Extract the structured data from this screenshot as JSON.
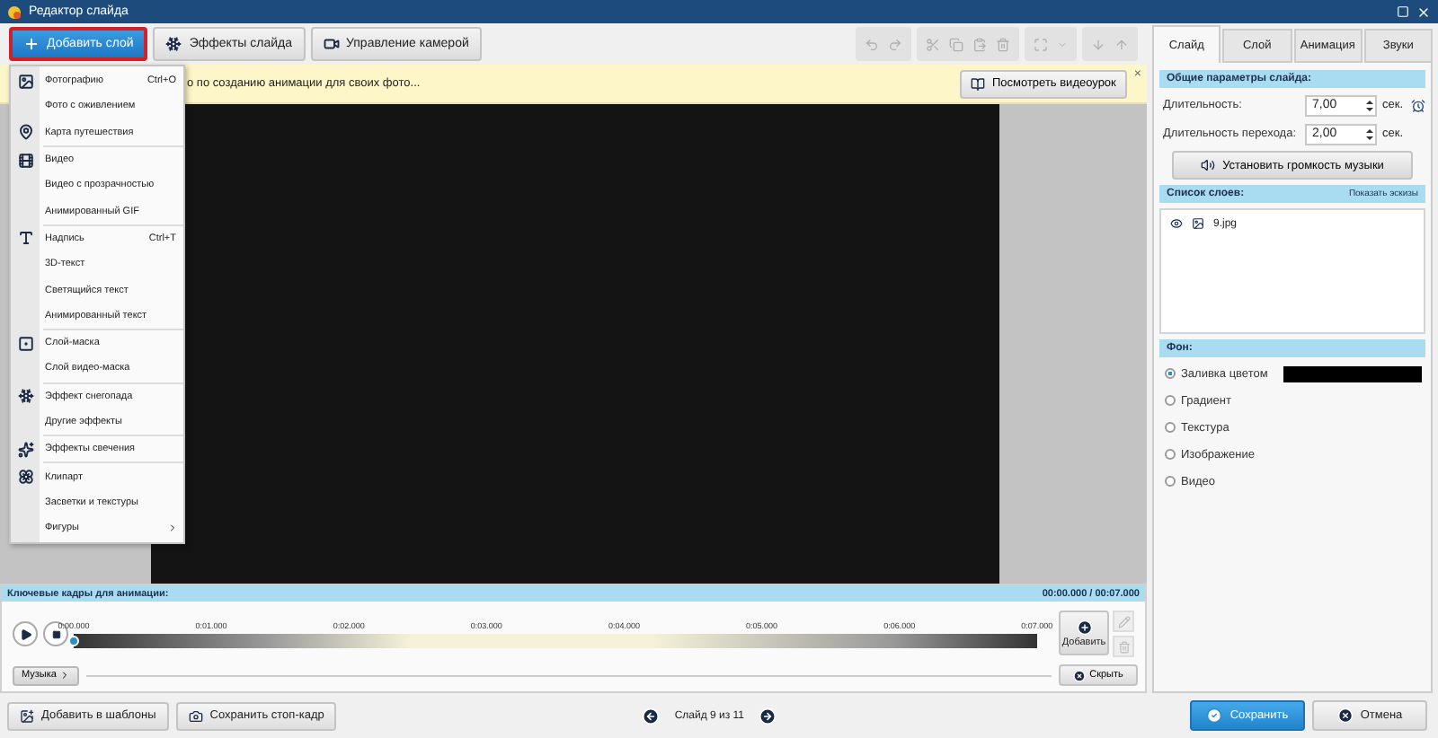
{
  "window": {
    "title": "Редактор слайда"
  },
  "toolbar": {
    "buttons": [
      {
        "label": "Добавить слой",
        "selected": true
      },
      {
        "label": "Эффекты слайда",
        "selected": false
      },
      {
        "label": "Управление камерой",
        "selected": false
      }
    ]
  },
  "add_layer_menu": {
    "groups": [
      {
        "items": [
          {
            "label": "Фотографию",
            "shortcut": "Ctrl+O"
          },
          {
            "label": "Фото с оживлением"
          },
          {
            "label": "Карта путешествия"
          }
        ]
      },
      {
        "items": [
          {
            "label": "Видео"
          },
          {
            "label": "Видео с прозрачностью"
          },
          {
            "label": "Анимированный GIF"
          }
        ]
      },
      {
        "items": [
          {
            "label": "Надпись",
            "shortcut": "Ctrl+T"
          },
          {
            "label": "3D-текст"
          },
          {
            "label": "Светящийся текст"
          },
          {
            "label": "Анимированный текст"
          }
        ]
      },
      {
        "items": [
          {
            "label": "Слой-маска"
          },
          {
            "label": "Слой видео-маска"
          }
        ]
      },
      {
        "items": [
          {
            "label": "Эффект снегопада"
          },
          {
            "label": "Другие эффекты"
          }
        ]
      },
      {
        "items": [
          {
            "label": "Эффекты свечения"
          }
        ]
      },
      {
        "items": [
          {
            "label": "Клипарт"
          },
          {
            "label": "Засветки и текстуры"
          },
          {
            "label": "Фигуры",
            "submenu": true
          }
        ]
      }
    ]
  },
  "info_bar": {
    "text": "о по созданию анимации для своих фото...",
    "button": "Посмотреть видеоурок",
    "close": "×"
  },
  "keyframes": {
    "title": "Ключевые кадры для анимации:",
    "time": "00:00.000 / 00:07.000",
    "ticks": [
      "0:00.000",
      "0:01.000",
      "0:02.000",
      "0:03.000",
      "0:04.000",
      "0:05.000",
      "0:06.000",
      "0:07.000"
    ],
    "add_button": "Добавить",
    "hide_button": "Скрыть",
    "music_button": "Музыка"
  },
  "bottom_bar": {
    "add_to_templates": "Добавить в шаблоны",
    "save_frame": "Сохранить стоп-кадр",
    "slide_counter": "Слайд 9 из 11",
    "save": "Сохранить",
    "cancel": "Отмена"
  },
  "panel": {
    "tabs": [
      {
        "label": "Слайд",
        "selected": true
      },
      {
        "label": "Слой",
        "selected": false
      },
      {
        "label": "Анимация",
        "selected": false
      },
      {
        "label": "Звуки",
        "selected": false
      }
    ],
    "general": {
      "title": "Общие параметры слайда:",
      "fields": [
        {
          "label": "Длительность:",
          "value": "7,00",
          "unit": "сек."
        },
        {
          "label": "Длительность перехода:",
          "value": "2,00",
          "unit": "сек."
        }
      ],
      "volume_button": "Установить громкость музыки"
    },
    "layers": {
      "title": "Список слоев:",
      "thumbs_link": "Показать эскизы",
      "items": [
        {
          "name": "9.jpg"
        }
      ]
    },
    "background": {
      "title": "Фон:",
      "options": [
        {
          "label": "Заливка цветом",
          "selected": true,
          "color": "#000000"
        },
        {
          "label": "Градиент",
          "selected": false
        },
        {
          "label": "Текстура",
          "selected": false
        },
        {
          "label": "Изображение",
          "selected": false
        },
        {
          "label": "Видео",
          "selected": false
        }
      ]
    }
  }
}
